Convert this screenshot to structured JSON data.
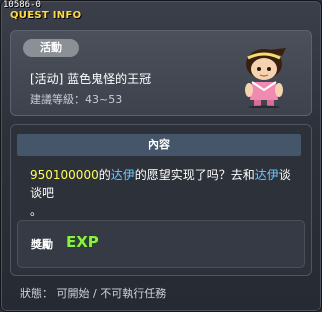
{
  "window": {
    "id_text": "10586-0",
    "title": "QUEST INFO"
  },
  "quest": {
    "category": "活動",
    "name": "[活动] 蓝色鬼怪的王冠",
    "level_requirement": "建議等級：43~53"
  },
  "content": {
    "header": "內容",
    "desc_line1_a": "950100000",
    "desc_line1_b": "的",
    "desc_line1_c": "达伊",
    "desc_line1_d": "的愿望实现了吗？去和",
    "desc_line1_e": "达伊",
    "desc_line1_f": "谈谈吧",
    "desc_line2": "。",
    "highlight_colors": {
      "number": "#ffff55",
      "npc_name": "#6cc8ff"
    }
  },
  "reward": {
    "label": "獎勵",
    "exp_text": "EXP",
    "exp_icon": "exp-icon"
  },
  "status": {
    "text": "狀態： 可開始 / 不可執行任務"
  }
}
